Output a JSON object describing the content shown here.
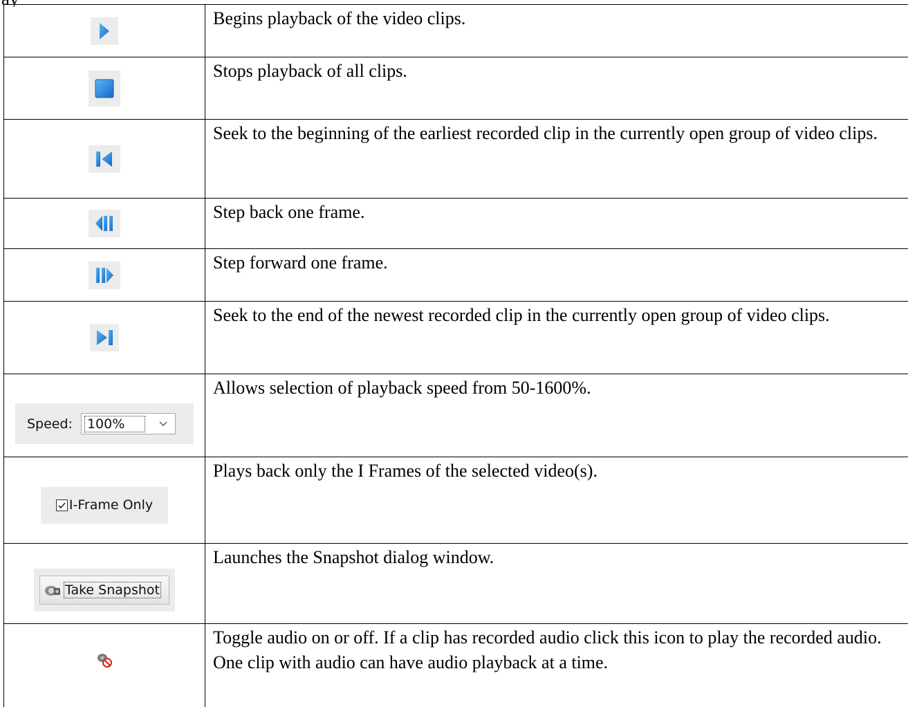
{
  "page_fragment": "ay",
  "rows": [
    {
      "icon": "play-icon",
      "description": "Begins playback of the video clips."
    },
    {
      "icon": "stop-icon",
      "description": "Stops playback of all clips."
    },
    {
      "icon": "seek-to-start-icon",
      "description": "Seek to the beginning of the earliest recorded clip in the currently open group of video clips."
    },
    {
      "icon": "step-back-icon",
      "description": "Step back one frame."
    },
    {
      "icon": "step-forward-icon",
      "description": "Step forward one frame."
    },
    {
      "icon": "seek-to-end-icon",
      "description": "Seek to the end of the newest recorded clip in the currently open group of video clips."
    },
    {
      "icon": "speed-dropdown",
      "description": "Allows selection of playback speed from 50-1600%."
    },
    {
      "icon": "iframe-only-checkbox",
      "description": "Plays back only the I Frames of the selected video(s)."
    },
    {
      "icon": "take-snapshot-button",
      "description": "Launches the Snapshot dialog window."
    },
    {
      "icon": "audio-muted-icon",
      "description": "Toggle audio on or off. If a clip has recorded audio click this icon to play the recorded audio.  One clip with audio can have audio playback at a time."
    }
  ],
  "widgets": {
    "speed_label": "Speed:",
    "speed_value": "100%",
    "iframe_label": "I-Frame Only",
    "iframe_checked": true,
    "snapshot_label": "Take Snapshot"
  },
  "colors": {
    "icon_blue": "#1e7fd8",
    "icon_blue_light": "#4aa3ef",
    "tile_background": "#ececec"
  }
}
